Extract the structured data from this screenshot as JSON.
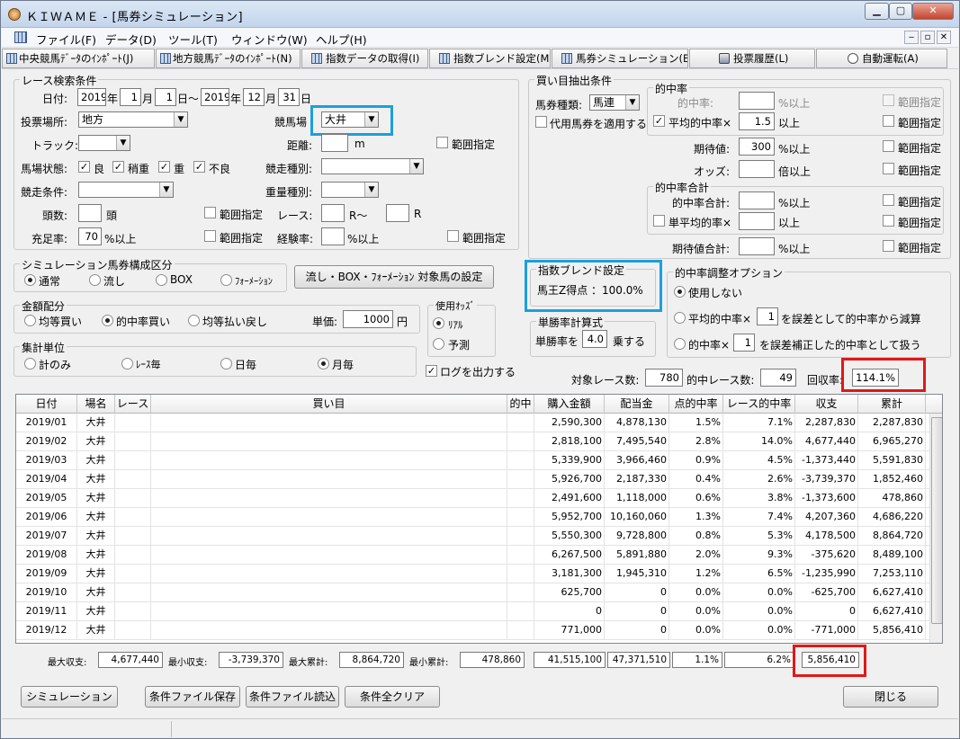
{
  "window": {
    "title": "ＫＩＷＡＭＥ - [馬券シミュレーション]"
  },
  "menu": [
    "ファイル(F)",
    "データ(D)",
    "ツール(T)",
    "ウィンドウ(W)",
    "ヘルプ(H)"
  ],
  "toolbar": [
    "中央競馬ﾃﾞｰﾀのｲﾝﾎﾟｰﾄ(J)",
    "地方競馬ﾃﾞｰﾀのｲﾝﾎﾟｰﾄ(N)",
    "指数データの取得(I)",
    "指数ブレンド設定(M)",
    "馬券シミュレーション(B)",
    "投票履歴(L)",
    "自動運転(A)"
  ],
  "race": {
    "group": "レース検索条件",
    "date_label": "日付:",
    "from_year": "2019",
    "from_month": "1",
    "from_day": "1",
    "to_year": "2019",
    "to_month": "12",
    "to_day": "31",
    "u_year": "年",
    "u_month": "月",
    "u_day": "日",
    "tilde": "日～",
    "u_day2": "日",
    "venue_label": "投票場所:",
    "venue": "地方",
    "track_name_label": "競馬場",
    "track_name": "大井",
    "track_label": "トラック:",
    "track": "",
    "distance_label": "距離:",
    "distance": "",
    "distance_unit": "m",
    "range_label": "範囲指定",
    "condition_label": "馬場状態:",
    "conditions": [
      "良",
      "稍重",
      "重",
      "不良"
    ],
    "race_type_label": "競走種別:",
    "race_type": "",
    "race_cond_label": "競走条件:",
    "race_cond": "",
    "weight_label": "重量種別:",
    "weight": "",
    "heads_label": "頭数:",
    "heads": "",
    "heads_unit": "頭",
    "race_label": "レース:",
    "race_from": "",
    "race_to": "",
    "r_tilde": "R～",
    "r_unit": "R",
    "fill_label": "充足率:",
    "fill": "70",
    "fill_unit": "%以上",
    "exp_label": "経験率:",
    "exp": "",
    "exp_unit": "%以上"
  },
  "buy": {
    "group": "買い目抽出条件",
    "bet_type_label": "馬券種類:",
    "bet_type": "馬連",
    "substitute_label": "代用馬券を適用する",
    "hit_group": "的中率",
    "hit_label": "的中率:",
    "hit": "",
    "hit_unit": "%以上",
    "avg_hit_label": "平均的中率×",
    "avg_hit": "1.5",
    "avg_hit_unit": "以上",
    "ev_label": "期待値:",
    "ev": "300",
    "ev_unit": "%以上",
    "odds_label": "オッズ:",
    "odds": "",
    "odds_unit": "倍以上",
    "sum_group": "的中率合計",
    "sum_hit_label": "的中率合計:",
    "sum_hit": "",
    "sum_hit_unit": "%以上",
    "single_avg_label": "単平均的率×",
    "single_avg": "",
    "single_avg_unit": "以上",
    "ev_sum_label": "期待値合計:",
    "ev_sum": "",
    "ev_sum_unit": "%以上",
    "range_label": "範囲指定"
  },
  "sim": {
    "group": "シミュレーション馬券構成区分",
    "options": [
      "通常",
      "流し",
      "BOX",
      "ﾌｫｰﾒｰｼｮﾝ"
    ],
    "setup_button": "流し・BOX・ﾌｫｰﾒｰｼｮﾝ 対象馬の設定"
  },
  "blend": {
    "group": "指数ブレンド設定",
    "text": "馬王Z得点 ：100.0%"
  },
  "adjust": {
    "group": "的中率調整オプション",
    "opt1": "使用しない",
    "opt2_pre": "平均的中率×",
    "opt2_val": "1",
    "opt2_post": "を誤差として的中率から減算",
    "opt3_pre": "的中率×",
    "opt3_val": "1",
    "opt3_post": "を誤差補正した的中率として扱う"
  },
  "money": {
    "group": "金額配分",
    "options": [
      "均等買い",
      "的中率買い",
      "均等払い戻し"
    ],
    "unit_label": "単価:",
    "unit": "1000",
    "unit_suffix": "円"
  },
  "odds": {
    "group": "使用ｵｯｽﾞ",
    "options": [
      "ﾘｱﾙ",
      "予測"
    ]
  },
  "single": {
    "group": "単勝率計算式",
    "pre": "単勝率を",
    "val": "4.0",
    "post": "乗する"
  },
  "agg": {
    "group": "集計単位",
    "options": [
      "計のみ",
      "ﾚｰｽ毎",
      "日毎",
      "月毎"
    ]
  },
  "log_label": "ログを出力する",
  "stats": {
    "target_label": "対象レース数:",
    "target": "780",
    "hit_label": "的中レース数:",
    "hit": "49",
    "rate_label": "回収率:",
    "rate": "114.1%"
  },
  "table": {
    "headers": [
      "日付",
      "場名",
      "レース",
      "買い目",
      "的中",
      "購入金額",
      "配当金",
      "点的中率",
      "レース的中率",
      "収支",
      "累計"
    ],
    "rows": [
      [
        "2019/01",
        "大井",
        "",
        "",
        "",
        "2,590,300",
        "4,878,130",
        "1.5%",
        "7.1%",
        "2,287,830",
        "2,287,830"
      ],
      [
        "2019/02",
        "大井",
        "",
        "",
        "",
        "2,818,100",
        "7,495,540",
        "2.8%",
        "14.0%",
        "4,677,440",
        "6,965,270"
      ],
      [
        "2019/03",
        "大井",
        "",
        "",
        "",
        "5,339,900",
        "3,966,460",
        "0.9%",
        "4.5%",
        "-1,373,440",
        "5,591,830"
      ],
      [
        "2019/04",
        "大井",
        "",
        "",
        "",
        "5,926,700",
        "2,187,330",
        "0.4%",
        "2.6%",
        "-3,739,370",
        "1,852,460"
      ],
      [
        "2019/05",
        "大井",
        "",
        "",
        "",
        "2,491,600",
        "1,118,000",
        "0.6%",
        "3.8%",
        "-1,373,600",
        "478,860"
      ],
      [
        "2019/06",
        "大井",
        "",
        "",
        "",
        "5,952,700",
        "10,160,060",
        "1.3%",
        "7.4%",
        "4,207,360",
        "4,686,220"
      ],
      [
        "2019/07",
        "大井",
        "",
        "",
        "",
        "5,550,300",
        "9,728,800",
        "0.8%",
        "5.3%",
        "4,178,500",
        "8,864,720"
      ],
      [
        "2019/08",
        "大井",
        "",
        "",
        "",
        "6,267,500",
        "5,891,880",
        "2.0%",
        "9.3%",
        "-375,620",
        "8,489,100"
      ],
      [
        "2019/09",
        "大井",
        "",
        "",
        "",
        "3,181,300",
        "1,945,310",
        "1.2%",
        "6.5%",
        "-1,235,990",
        "7,253,110"
      ],
      [
        "2019/10",
        "大井",
        "",
        "",
        "",
        "625,700",
        "0",
        "0.0%",
        "0.0%",
        "-625,700",
        "6,627,410"
      ],
      [
        "2019/11",
        "大井",
        "",
        "",
        "",
        "0",
        "0",
        "0.0%",
        "0.0%",
        "0",
        "6,627,410"
      ],
      [
        "2019/12",
        "大井",
        "",
        "",
        "",
        "771,000",
        "0",
        "0.0%",
        "0.0%",
        "-771,000",
        "5,856,410"
      ]
    ]
  },
  "summary": {
    "max_profit_label": "最大収支:",
    "max_profit": "4,677,440",
    "min_profit_label": "最小収支:",
    "min_profit": "-3,739,370",
    "max_cum_label": "最大累計:",
    "max_cum": "8,864,720",
    "min_cum_label": "最小累計:",
    "min_cum": "478,860",
    "total_buy": "41,515,100",
    "total_pay": "47,371,510",
    "total_hit": "1.1%",
    "total_race_hit": "6.2%",
    "total_profit": "5,856,410"
  },
  "buttons": {
    "simulate": "シミュレーション",
    "save": "条件ファイル保存",
    "load": "条件ファイル読込",
    "clear": "条件全クリア",
    "close": "閉じる"
  },
  "colors": {
    "highlight_blue": "#1aa0e0",
    "highlight_red": "#e01818"
  }
}
